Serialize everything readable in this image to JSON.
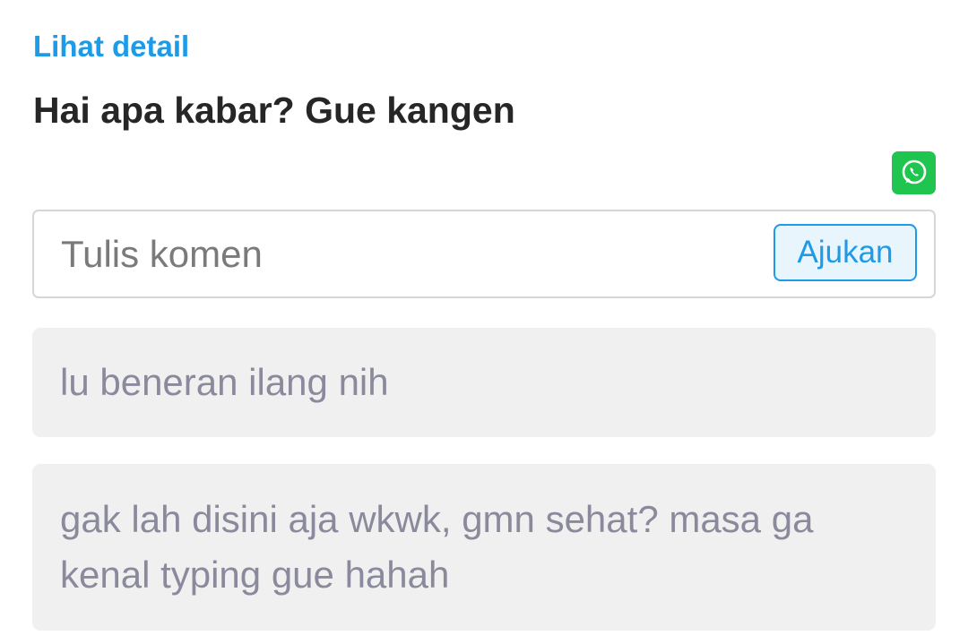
{
  "post": {
    "detail_link": "Lihat detail",
    "text": "Hai apa kabar? Gue kangen"
  },
  "share": {
    "icon": "whatsapp-icon",
    "color": "#1fc54f"
  },
  "comment_form": {
    "placeholder": "Tulis komen",
    "value": "",
    "submit_label": "Ajukan"
  },
  "comments": [
    {
      "text": "lu beneran ilang nih"
    },
    {
      "text": "gak lah disini aja wkwk, gmn sehat? masa ga kenal typing gue hahah"
    }
  ],
  "colors": {
    "accent": "#1e9be6",
    "comment_bg": "#f0f0f0",
    "comment_text": "#8a8a9c"
  }
}
